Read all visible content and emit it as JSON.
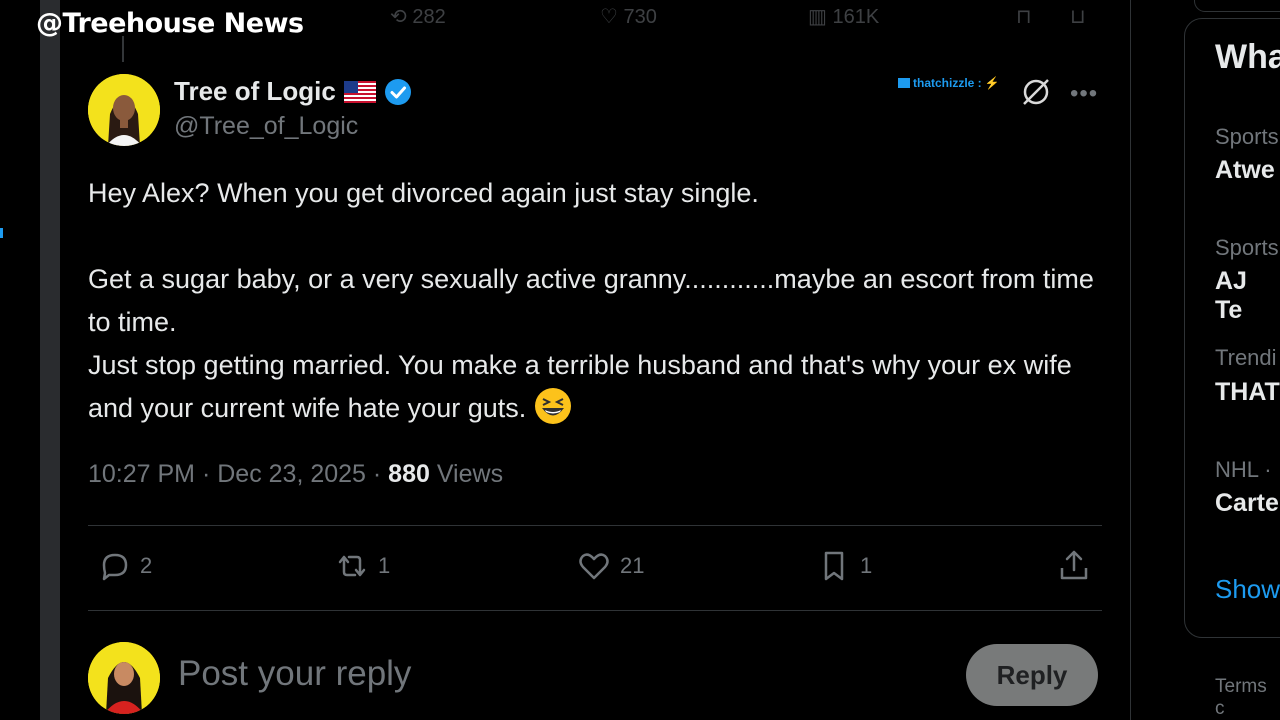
{
  "watermark": "@Treehouse News",
  "ghost_stats": {
    "replies": "282",
    "likes": "730",
    "views": "161K"
  },
  "tweet": {
    "author_name": "Tree of Logic",
    "handle": "@Tree_of_Logic",
    "promo_label": "thatchizzle :",
    "text": "Hey Alex? When you get divorced again just stay single.\n\nGet a sugar baby, or a very sexually active granny............maybe an escort from time to time.\nJust stop getting married. You make a terrible husband and that's why your ex wife and your current wife hate your guts. ",
    "emoji_icon": "grinning-squinting-face-icon",
    "time": "10:27 PM",
    "sep1": " · ",
    "date": "Dec 23, 2025",
    "sep2": " · ",
    "views_count": "880",
    "views_label": " Views"
  },
  "actions": {
    "replies": "2",
    "reposts": "1",
    "likes": "21",
    "bookmarks": "1"
  },
  "reply_box": {
    "placeholder": "Post your reply",
    "button_label": "Reply"
  },
  "right_panel": {
    "title": "Wha",
    "items": [
      {
        "category": "Sports",
        "title": "Atwe"
      },
      {
        "category": "Sports",
        "title": "AJ Te"
      },
      {
        "category": "Trendi",
        "title": "THAT"
      },
      {
        "category": "NHL · ",
        "title": "Carte"
      }
    ],
    "show_more": "Show",
    "terms": "Terms c"
  },
  "colors": {
    "accent": "#1d9bf0",
    "background": "#000000",
    "muted": "#71767b",
    "text": "#e7e9ea"
  }
}
